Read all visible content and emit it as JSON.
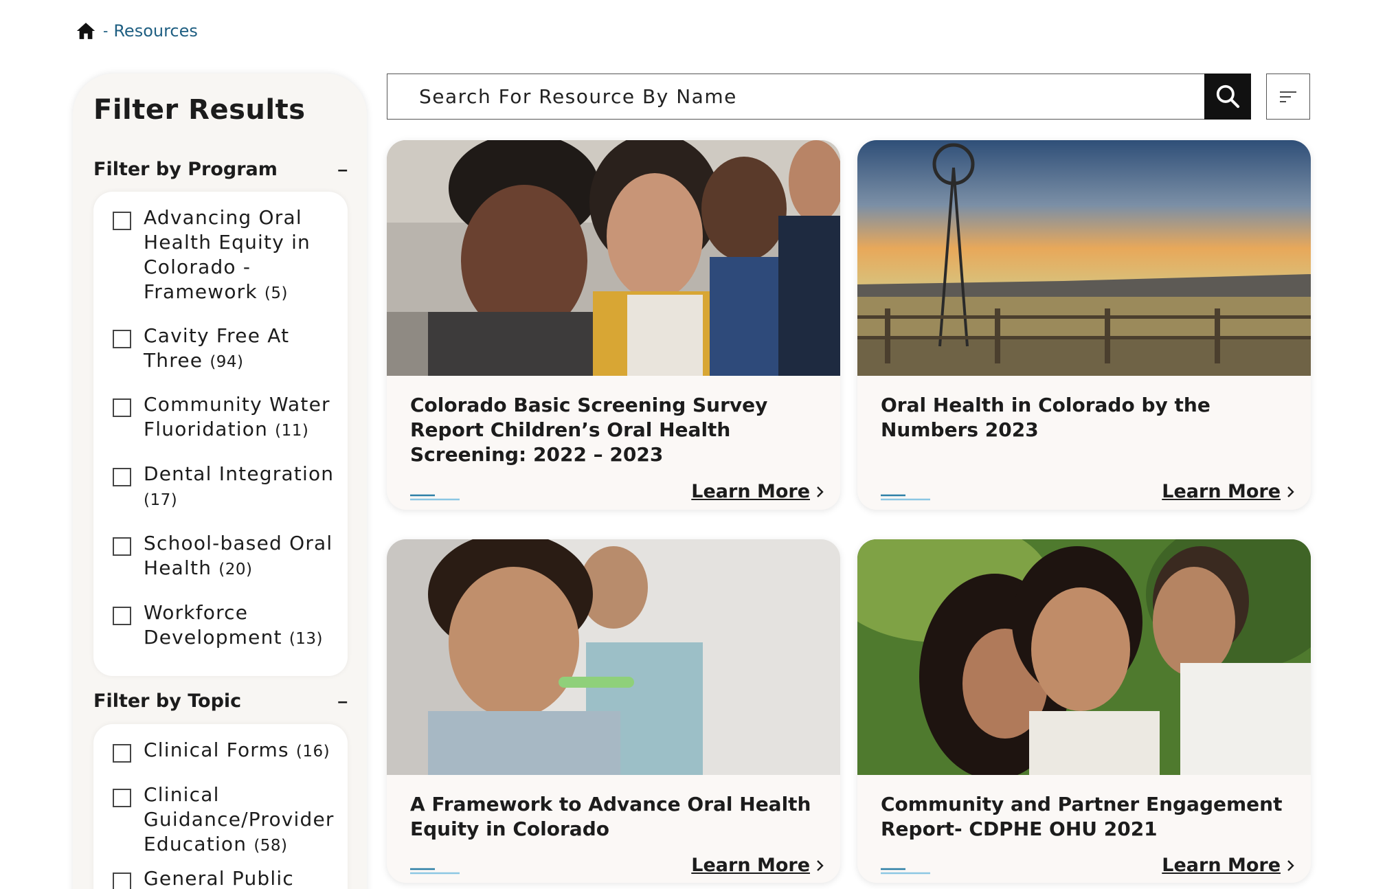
{
  "breadcrumb": {
    "home_icon": "home-icon",
    "separator": "-",
    "current": "Resources"
  },
  "sidebar": {
    "title": "Filter Results",
    "program": {
      "heading": "Filter by Program",
      "toggle": "–",
      "options": [
        {
          "label": "Advancing Oral Health Equity in Colorado - Framework",
          "count": "(5)"
        },
        {
          "label": "Cavity Free At Three",
          "count": "(94)"
        },
        {
          "label": "Community Water Fluoridation",
          "count": "(11)"
        },
        {
          "label": "Dental Integration",
          "count": "(17)"
        },
        {
          "label": "School-based Oral Health",
          "count": "(20)"
        },
        {
          "label": "Workforce Development",
          "count": "(13)"
        }
      ]
    },
    "topic": {
      "heading": "Filter by Topic",
      "toggle": "–",
      "options": [
        {
          "label": "Clinical Forms",
          "count": "(16)"
        },
        {
          "label": "Clinical Guidance/Provider Education",
          "count": "(58)"
        },
        {
          "label": "General Public",
          "count": ""
        }
      ]
    }
  },
  "search": {
    "placeholder": "Search For Resource By Name",
    "search_icon": "search-icon",
    "sort_icon": "sort-lines-icon"
  },
  "cards": [
    {
      "title": "Colorado Basic Screening Survey Report Children’s Oral Health Screening: 2022 – 2023",
      "link": "Learn More",
      "image": "photo-group-of-smiling-children"
    },
    {
      "title": "Oral Health in Colorado by the Numbers 2023",
      "link": "Learn More",
      "image": "photo-windmill-at-sunset-on-prairie"
    },
    {
      "title": "A Framework to Advance Oral Health Equity in Colorado",
      "link": "Learn More",
      "image": "photo-child-brushing-teeth-with-father"
    },
    {
      "title": "Community and Partner Engagement Report- CDPHE OHU 2021",
      "link": "Learn More",
      "image": "photo-mother-with-two-children-outdoors"
    }
  ],
  "colors": {
    "link_blue": "#1f5f82",
    "accent_dark": "#2c7fa6",
    "accent_light": "#8cc7e3",
    "sidebar_bg": "#f8f6f3",
    "card_bg": "#fbf8f6"
  }
}
